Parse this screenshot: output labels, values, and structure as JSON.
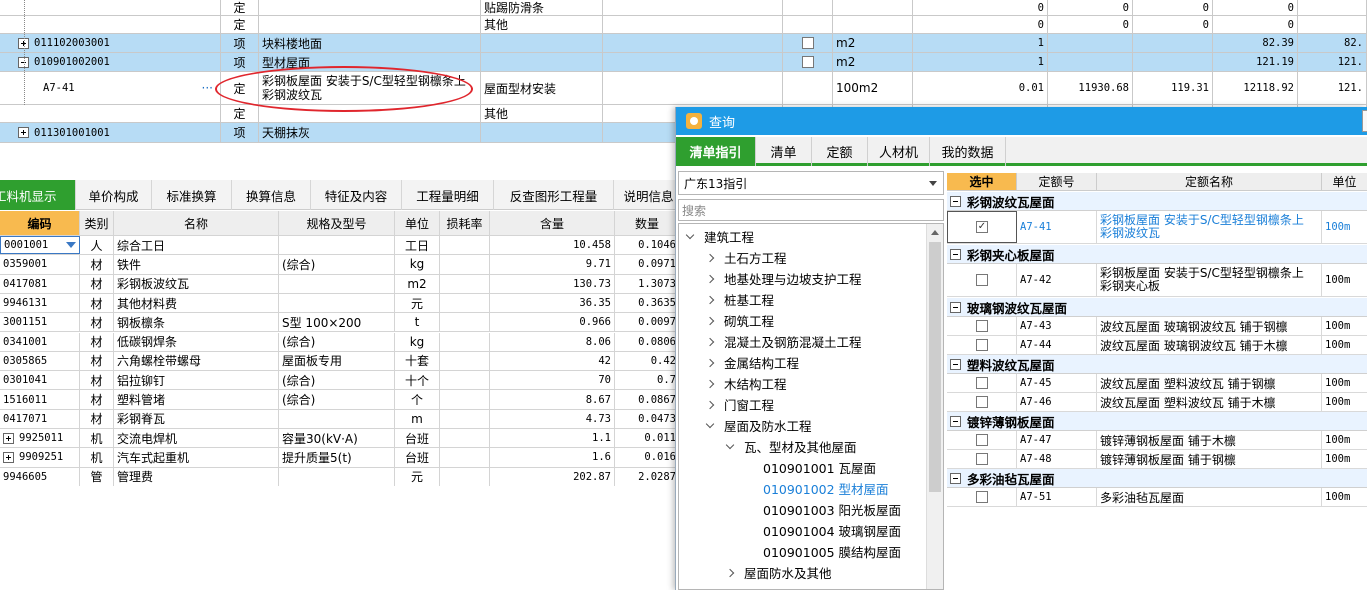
{
  "top_rows": [
    {
      "code": "",
      "type": "定",
      "name": "",
      "feature": "贴踢防滑条",
      "unit": "",
      "qty": "0",
      "price": "0",
      "c8": "0",
      "c9": "0",
      "c10": ""
    },
    {
      "code": "",
      "type": "定",
      "name": "",
      "feature": "其他",
      "unit": "",
      "qty": "0",
      "price": "0",
      "c8": "0",
      "c9": "0",
      "c10": ""
    },
    {
      "code": "011102003001",
      "type": "项",
      "name": "块料楼地面",
      "feature": "",
      "unit": "m2",
      "qty": "1",
      "price": "",
      "c8": "",
      "c9": "82.39",
      "c10": "82."
    },
    {
      "code": "010901002001",
      "type": "项",
      "name": "型材屋面",
      "feature": "",
      "unit": "m2",
      "qty": "1",
      "price": "",
      "c8": "",
      "c9": "121.19",
      "c10": "121."
    },
    {
      "code": "A7-41",
      "type": "定",
      "name": "彩钢板屋面 安装于S/C型轻型钢檩条上 彩钢波纹瓦",
      "feature": "屋面型材安装",
      "unit": "100m2",
      "qty": "0.01",
      "price": "11930.68",
      "c8": "119.31",
      "c9": "12118.92",
      "c10": "121."
    },
    {
      "code": "",
      "type": "定",
      "name": "",
      "feature": "其他",
      "unit": "",
      "qty": "",
      "price": "",
      "c8": "",
      "c9": "",
      "c10": ""
    },
    {
      "code": "011301001001",
      "type": "项",
      "name": "天棚抹灰",
      "feature": "",
      "unit": "",
      "qty": "",
      "price": "",
      "c8": "",
      "c9": "",
      "c10": ""
    }
  ],
  "ellipsis": "···",
  "tabs": [
    "工料机显示",
    "单价构成",
    "标准换算",
    "换算信息",
    "特征及内容",
    "工程量明细",
    "反查图形工程量",
    "说明信息"
  ],
  "bottom_headers": {
    "code": "编码",
    "type": "类别",
    "name": "名称",
    "spec": "规格及型号",
    "unit": "单位",
    "loss": "损耗率",
    "content": "含量",
    "qty": "数量"
  },
  "bottom_rows": [
    {
      "code": "0001001",
      "type": "人",
      "name": "综合工日",
      "spec": "",
      "unit": "工日",
      "content": "10.458",
      "qty": "0.1046"
    },
    {
      "code": "0359001",
      "type": "材",
      "name": "铁件",
      "spec": "(综合)",
      "unit": "kg",
      "content": "9.71",
      "qty": "0.0971"
    },
    {
      "code": "0417081",
      "type": "材",
      "name": "彩钢板波纹瓦",
      "spec": "",
      "unit": "m2",
      "content": "130.73",
      "qty": "1.3073"
    },
    {
      "code": "9946131",
      "type": "材",
      "name": "其他材料费",
      "spec": "",
      "unit": "元",
      "content": "36.35",
      "qty": "0.3635"
    },
    {
      "code": "3001151",
      "type": "材",
      "name": "钢板檩条",
      "spec": "S型 100×200",
      "unit": "t",
      "content": "0.966",
      "qty": "0.0097"
    },
    {
      "code": "0341001",
      "type": "材",
      "name": "低碳钢焊条",
      "spec": "(综合)",
      "unit": "kg",
      "content": "8.06",
      "qty": "0.0806"
    },
    {
      "code": "0305865",
      "type": "材",
      "name": "六角螺栓带螺母",
      "spec": "屋面板专用",
      "unit": "十套",
      "content": "42",
      "qty": "0.42"
    },
    {
      "code": "0301041",
      "type": "材",
      "name": "铝拉铆钉",
      "spec": "(综合)",
      "unit": "十个",
      "content": "70",
      "qty": "0.7"
    },
    {
      "code": "1516011",
      "type": "材",
      "name": "塑料管堵",
      "spec": "(综合)",
      "unit": "个",
      "content": "8.67",
      "qty": "0.0867"
    },
    {
      "code": "0417071",
      "type": "材",
      "name": "彩钢脊瓦",
      "spec": "",
      "unit": "m",
      "content": "4.73",
      "qty": "0.0473"
    },
    {
      "code": "9925011",
      "type": "机",
      "name": "交流电焊机",
      "spec": "容量30(kV·A)",
      "unit": "台班",
      "content": "1.1",
      "qty": "0.011"
    },
    {
      "code": "9909251",
      "type": "机",
      "name": "汽车式起重机",
      "spec": "提升质量5(t)",
      "unit": "台班",
      "content": "1.6",
      "qty": "0.016"
    },
    {
      "code": "9946605",
      "type": "管",
      "name": "管理费",
      "spec": "",
      "unit": "元",
      "content": "202.87",
      "qty": "2.0287"
    }
  ],
  "dialog": {
    "title": "查询",
    "tabs": [
      "清单指引",
      "清单",
      "定额",
      "人材机",
      "我的数据"
    ],
    "select_value": "广东13指引",
    "search_placeholder": "搜索",
    "tree": [
      {
        "label": "建筑工程",
        "level": 0,
        "state": "open"
      },
      {
        "label": "土石方工程",
        "level": 1,
        "state": "closed"
      },
      {
        "label": "地基处理与边坡支护工程",
        "level": 1,
        "state": "closed"
      },
      {
        "label": "桩基工程",
        "level": 1,
        "state": "closed"
      },
      {
        "label": "砌筑工程",
        "level": 1,
        "state": "closed"
      },
      {
        "label": "混凝土及钢筋混凝土工程",
        "level": 1,
        "state": "closed"
      },
      {
        "label": "金属结构工程",
        "level": 1,
        "state": "closed"
      },
      {
        "label": "木结构工程",
        "level": 1,
        "state": "closed"
      },
      {
        "label": "门窗工程",
        "level": 1,
        "state": "closed"
      },
      {
        "label": "屋面及防水工程",
        "level": 1,
        "state": "open"
      },
      {
        "label": "瓦、型材及其他屋面",
        "level": 2,
        "state": "open"
      },
      {
        "label": "010901001  瓦屋面",
        "level": 3,
        "state": "leaf"
      },
      {
        "label": "010901002  型材屋面",
        "level": 3,
        "state": "selected"
      },
      {
        "label": "010901003  阳光板屋面",
        "level": 3,
        "state": "leaf"
      },
      {
        "label": "010901004  玻璃钢屋面",
        "level": 3,
        "state": "leaf"
      },
      {
        "label": "010901005  膜结构屋面",
        "level": 3,
        "state": "leaf"
      },
      {
        "label": "屋面防水及其他",
        "level": 2,
        "state": "closed"
      }
    ],
    "right_headers": {
      "select": "选中",
      "code": "定额号",
      "name": "定额名称",
      "unit": "单位"
    },
    "groups": [
      {
        "title": "彩钢波纹瓦屋面",
        "items": [
          {
            "code": "A7-41",
            "name": "彩钢板屋面 安装于S/C型轻型钢檩条上 彩钢波纹瓦",
            "unit": "100m",
            "checked": true
          }
        ]
      },
      {
        "title": "彩钢夹心板屋面",
        "items": [
          {
            "code": "A7-42",
            "name": "彩钢板屋面 安装于S/C型轻型钢檩条上 彩钢夹心板",
            "unit": "100m",
            "checked": false
          }
        ]
      },
      {
        "title": "玻璃钢波纹瓦屋面",
        "items": [
          {
            "code": "A7-43",
            "name": "波纹瓦屋面 玻璃钢波纹瓦 铺于钢檩",
            "unit": "100m",
            "checked": false
          },
          {
            "code": "A7-44",
            "name": "波纹瓦屋面 玻璃钢波纹瓦 铺于木檩",
            "unit": "100m",
            "checked": false
          }
        ]
      },
      {
        "title": "塑料波纹瓦屋面",
        "items": [
          {
            "code": "A7-45",
            "name": "波纹瓦屋面 塑料波纹瓦 铺于钢檩",
            "unit": "100m",
            "checked": false
          },
          {
            "code": "A7-46",
            "name": "波纹瓦屋面 塑料波纹瓦 铺于木檩",
            "unit": "100m",
            "checked": false
          }
        ]
      },
      {
        "title": "镀锌薄钢板屋面",
        "items": [
          {
            "code": "A7-47",
            "name": "镀锌薄钢板屋面 铺于木檩",
            "unit": "100m",
            "checked": false
          },
          {
            "code": "A7-48",
            "name": "镀锌薄钢板屋面 铺于钢檩",
            "unit": "100m",
            "checked": false
          }
        ]
      },
      {
        "title": "多彩油毡瓦屋面",
        "items": [
          {
            "code": "A7-51",
            "name": "多彩油毡瓦屋面",
            "unit": "100m",
            "checked": false
          }
        ]
      }
    ]
  }
}
